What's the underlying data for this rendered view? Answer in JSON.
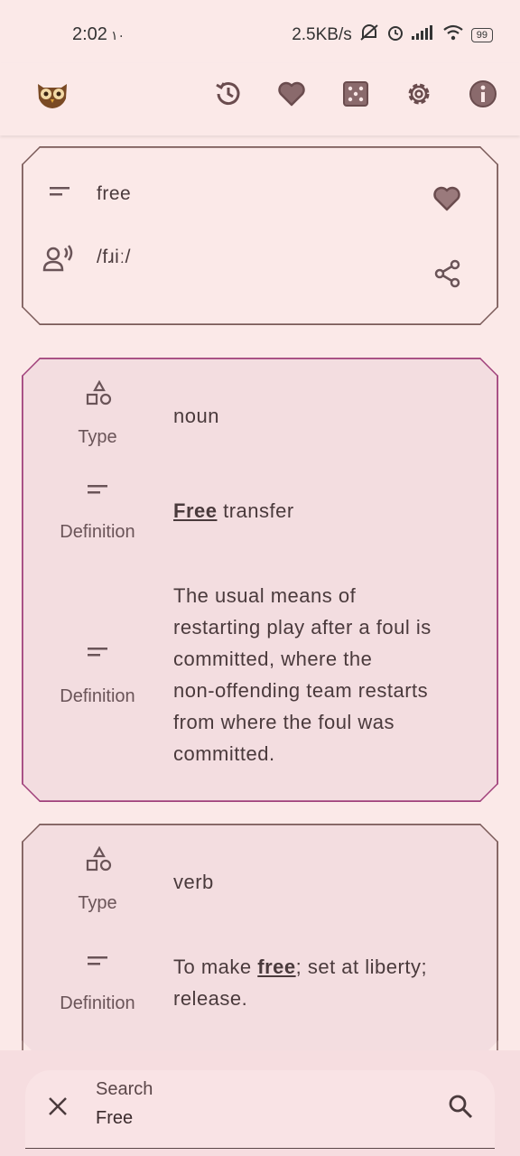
{
  "status": {
    "time": "2:02",
    "time_suffix": "١٠",
    "net_speed": "2.5KB/s",
    "battery": "99"
  },
  "app_bar": {
    "icons": [
      "owl-logo-icon",
      "history-icon",
      "heart-icon",
      "dice-icon",
      "settings-icon",
      "info-icon"
    ]
  },
  "word_card": {
    "word": "free",
    "pronunciation": "/fɹiː/"
  },
  "entries": [
    {
      "type_label": "Type",
      "type_value": "noun",
      "definitions": [
        {
          "label": "Definition",
          "bold": "Free",
          "rest": " transfer"
        },
        {
          "label": "Definition",
          "lines": [
            "The usual means of",
            "restarting play after a foul is",
            "committed, where the",
            "non-offending team restarts",
            "from where the foul was",
            "committed."
          ]
        }
      ]
    },
    {
      "type_label": "Type",
      "type_value": "verb",
      "definitions": [
        {
          "label": "Definition",
          "pre": "To make ",
          "bold": "free",
          "post": "; set at liberty;",
          "line2": "release."
        }
      ]
    }
  ],
  "search": {
    "label": "Search",
    "value": "Free"
  },
  "colors": {
    "background": "#fbe9e8",
    "card_highlight": "#f3dde0",
    "accent_border": "#a0407a"
  }
}
